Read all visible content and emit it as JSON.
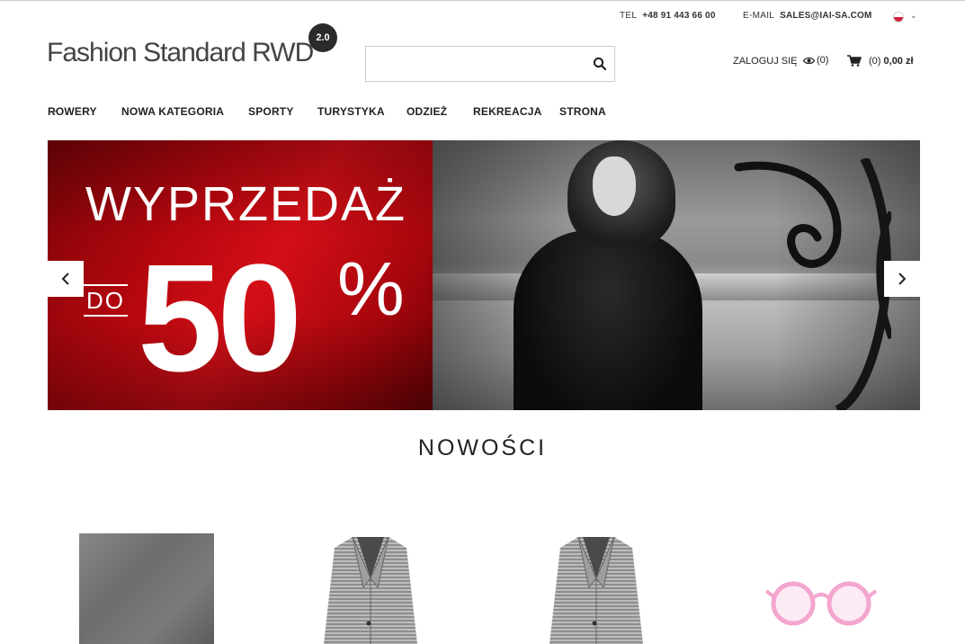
{
  "topbar": {
    "tel_label": "TEL",
    "tel_value": "+48 91 443 66 00",
    "email_label": "E-MAIL",
    "email_value": "SALES@IAI-SA.COM",
    "language_icon": "flag-poland-icon"
  },
  "header": {
    "logo_text": "Fashion Standard RWD",
    "logo_badge": "2.0",
    "search_placeholder": "",
    "login_label": "ZALOGUJ SIĘ",
    "watch_count": "(0)",
    "cart_count": "(0)",
    "cart_total": "0,00 zł"
  },
  "nav": {
    "items": [
      "ROWERY",
      "NOWA KATEGORIA",
      "SPORTY",
      "TURYSTYKA",
      "ODZIEŻ",
      "REKREACJA",
      "STRONA"
    ]
  },
  "banner": {
    "headline": "WYPRZEDAŻ",
    "prefix": "DO",
    "amount": "50",
    "percent": "%",
    "colors": {
      "accent": "#c8080f"
    }
  },
  "section": {
    "title": "NOWOŚCI"
  }
}
